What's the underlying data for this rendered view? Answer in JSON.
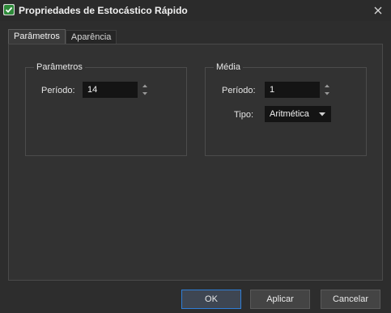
{
  "window": {
    "title": "Propriedades de Estocástico Rápido",
    "close_label": "✕"
  },
  "tabs": [
    {
      "label": "Parâmetros",
      "active": true
    },
    {
      "label": "Aparência",
      "active": false
    }
  ],
  "parameters_group": {
    "title": "Parâmetros",
    "period_label": "Período:",
    "period_value": "14"
  },
  "average_group": {
    "title": "Média",
    "period_label": "Período:",
    "period_value": "1",
    "type_label": "Tipo:",
    "type_value": "Aritmética"
  },
  "buttons": {
    "ok": "OK",
    "apply": "Aplicar",
    "cancel": "Cancelar"
  },
  "colors": {
    "background": "#2d2d2d",
    "input_bg": "#141414",
    "accent_border": "#2f7ed8",
    "icon_check": "#2e8b3a"
  },
  "icons": {
    "app": "checkbox-chart-icon",
    "close": "close-icon",
    "spin": "spin-arrows-icon",
    "dropdown": "chevron-down-icon"
  }
}
